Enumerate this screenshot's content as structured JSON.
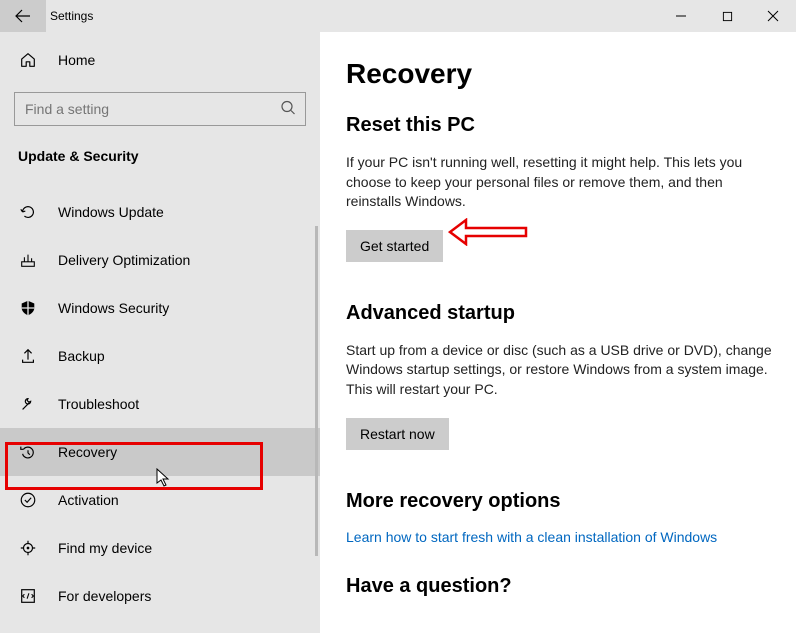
{
  "titlebar": {
    "title": "Settings"
  },
  "sidebar": {
    "home_label": "Home",
    "search_placeholder": "Find a setting",
    "group_header": "Update & Security",
    "items": [
      {
        "icon": "refresh-icon",
        "label": "Windows Update",
        "selected": false
      },
      {
        "icon": "optimize-icon",
        "label": "Delivery Optimization",
        "selected": false
      },
      {
        "icon": "shield-icon",
        "label": "Windows Security",
        "selected": false
      },
      {
        "icon": "upload-icon",
        "label": "Backup",
        "selected": false
      },
      {
        "icon": "wrench-icon",
        "label": "Troubleshoot",
        "selected": false
      },
      {
        "icon": "recovery-icon",
        "label": "Recovery",
        "selected": true
      },
      {
        "icon": "check-icon",
        "label": "Activation",
        "selected": false
      },
      {
        "icon": "locate-icon",
        "label": "Find my device",
        "selected": false
      },
      {
        "icon": "dev-icon",
        "label": "For developers",
        "selected": false
      }
    ]
  },
  "content": {
    "page_title": "Recovery",
    "reset": {
      "heading": "Reset this PC",
      "body": "If your PC isn't running well, resetting it might help. This lets you choose to keep your personal files or remove them, and then reinstalls Windows.",
      "button": "Get started"
    },
    "advanced": {
      "heading": "Advanced startup",
      "body": "Start up from a device or disc (such as a USB drive or DVD), change Windows startup settings, or restore Windows from a system image. This will restart your PC.",
      "button": "Restart now"
    },
    "more": {
      "heading": "More recovery options",
      "link": "Learn how to start fresh with a clean installation of Windows"
    },
    "question_heading": "Have a question?"
  },
  "annotations": {
    "hint": "Red box around Recovery nav item; red outlined arrow pointing at Get started button"
  }
}
